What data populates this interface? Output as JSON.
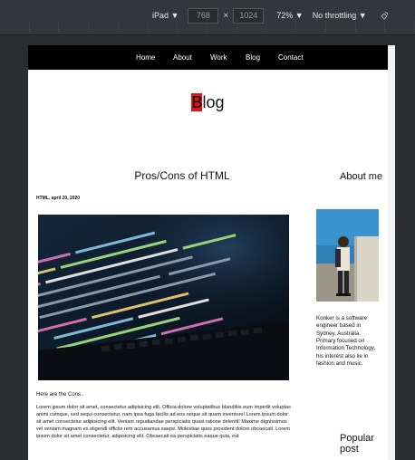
{
  "devtools": {
    "device": "iPad ▼",
    "width": "768",
    "times": "×",
    "height": "1024",
    "zoom": "72% ▼",
    "throttling": "No throttling ▼"
  },
  "nav": {
    "items": [
      "Home",
      "About",
      "Work",
      "Blog",
      "Contact"
    ]
  },
  "blog": {
    "title_first": "B",
    "title_rest": "log"
  },
  "post": {
    "title": "Pros/Cons of HTML",
    "meta": "HTML, april 20, 2020",
    "lead": "Here are the Cons..",
    "body": "Lorem ipsum dolor sit amet, consectetur adipisicing elit. Officia dolore voluptatibus blanditiis eum impedit voluptas animi cumque, sed sequi consectetur, nam ipsa fuga facilis ad eos neque sit quam inventore! Lorem ipsum dolor sit amet consectetur adipisicing elit. Veniam repudiandae perspiciatis quasi ratione deleniti! Maxime dignissimos vel veniam magnam ex eligendi officiis rem accusamus saepe. Molestiae quos provident dolore obcaecati. Lorem ipsum dolor sit amet consectetur, adipisicing elit. Obcaecati ea perspiciatis eaque quia, est"
  },
  "about": {
    "title": "About me",
    "text": "Konker is a software engineer based in Sydney, Australia. Primary focused on Information Technology, his interest also lie in fashion and music."
  },
  "popular": {
    "title": "Popular post"
  },
  "icons": {
    "rotate": "rotate-icon"
  }
}
